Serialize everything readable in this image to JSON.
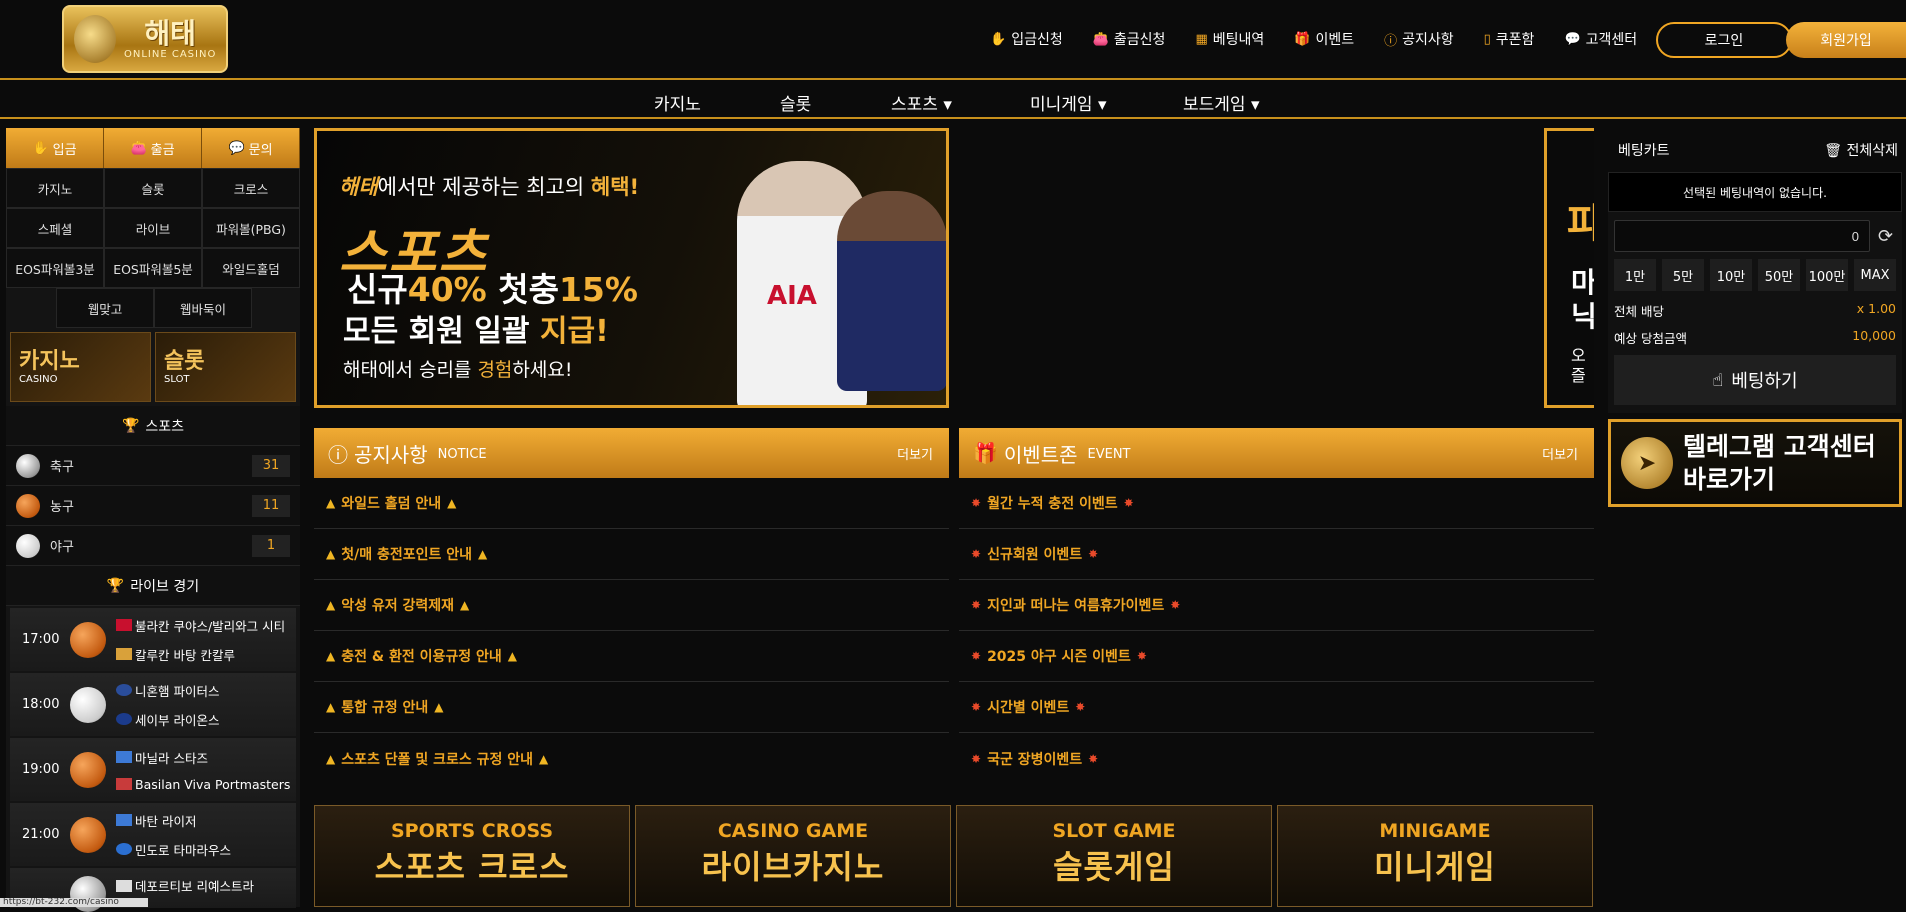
{
  "header": {
    "logo_text": "해태",
    "logo_sub": "ONLINE CASINO",
    "nav": [
      {
        "icon": "deposit-icon",
        "label": "입금신청"
      },
      {
        "icon": "withdraw-icon",
        "label": "출금신청"
      },
      {
        "icon": "history-icon",
        "label": "베팅내역"
      },
      {
        "icon": "gift-icon",
        "label": "이벤트"
      },
      {
        "icon": "notice-icon",
        "label": "공지사항"
      },
      {
        "icon": "coupon-icon",
        "label": "쿠폰함"
      },
      {
        "icon": "support-icon",
        "label": "고객센터"
      }
    ],
    "login": "로그인",
    "join": "회원가입"
  },
  "main_nav": [
    "카지노",
    "슬롯",
    "스포츠 ▾",
    "미니게임 ▾",
    "보드게임 ▾"
  ],
  "left": {
    "quick": [
      "입금",
      "출금",
      "문의"
    ],
    "games": [
      "카지노",
      "슬롯",
      "크로스",
      "스페셜",
      "라이브",
      "파워볼(PBG)",
      "EOS파워볼3분",
      "EOS파워볼5분",
      "와일드홀덤"
    ],
    "games2": [
      "웹맞고",
      "웹바둑이"
    ],
    "promo": [
      {
        "title": "카지노",
        "sub": "CASINO"
      },
      {
        "title": "슬롯",
        "sub": "SLOT"
      }
    ],
    "sports_title": "스포츠",
    "sports": [
      {
        "name": "축구",
        "count": "31"
      },
      {
        "name": "농구",
        "count": "11"
      },
      {
        "name": "야구",
        "count": "1"
      }
    ],
    "live_title": "라이브 경기",
    "live": [
      {
        "time": "17:00",
        "home": "불라칸 쿠야스/발리와그 시티",
        "away": "칼루칸 바탕 칸칼루"
      },
      {
        "time": "18:00",
        "home": "니혼햄 파이터스",
        "away": "세이부 라이온스"
      },
      {
        "time": "19:00",
        "home": "마닐라 스타즈",
        "away": "Basilan Viva Portmasters"
      },
      {
        "time": "21:00",
        "home": "바탄 라이저",
        "away": "민도로 타마라우스"
      },
      {
        "time": "",
        "home": "데포르티보 리예스트라",
        "away": ""
      }
    ],
    "status_url": "https://bt-232.com/casino"
  },
  "banner": {
    "line1_brand": "해태",
    "line1_rest": "에서만 제공하는 최고의 ",
    "line1_accent": "혜택!",
    "line2": "스포츠",
    "line3_a": "신규",
    "line3_b": "40%",
    "line3_c": " 첫충",
    "line3_d": "15%",
    "line4_a": "모든 회원 일괄 ",
    "line4_b": "지급!",
    "line5_a": "해태에서 승리를 ",
    "line5_b": "경험",
    "line5_c": "하세요!",
    "jersey": "AIA"
  },
  "banner2": {
    "a": "파",
    "b": "마\n닉",
    "c": "오\n즐"
  },
  "notice": {
    "title": "공지사항",
    "sub": "NOTICE",
    "more": "더보기",
    "items": [
      "와일드 홀덤 안내",
      "첫/매 충전포인트 안내",
      "악성 유저 강력제재",
      "충전 & 환전 이용규정 안내",
      "통합 규정 안내",
      "스포츠 단폴 및 크로스 규정 안내"
    ]
  },
  "event": {
    "title": "이벤트존",
    "sub": "EVENT",
    "more": "더보기",
    "items": [
      "월간 누적 충전 이벤트",
      "신규회원 이벤트",
      "지인과 떠나는 여름휴가이벤트",
      "2025 야구 시즌 이벤트",
      "시간별 이벤트",
      "국군 장병이벤트"
    ]
  },
  "games": [
    {
      "en": "SPORTS CROSS",
      "kr": "스포츠 크로스"
    },
    {
      "en": "CASINO GAME",
      "kr": "라이브카지노"
    },
    {
      "en": "SLOT GAME",
      "kr": "슬롯게임"
    },
    {
      "en": "MINIGAME",
      "kr": "미니게임"
    }
  ],
  "cart": {
    "title": "베팅카트",
    "clear": "전체삭제",
    "empty": "선택된 베팅내역이 없습니다.",
    "amount": "0",
    "chips": [
      "1만",
      "5만",
      "10만",
      "50만",
      "100만",
      "MAX"
    ],
    "total_odds_label": "전체 배당",
    "total_odds": "x 1.00",
    "expected_label": "예상 당첨금액",
    "expected": "10,000",
    "bet": "베팅하기"
  },
  "telegram": {
    "line1": "텔레그램 고객센터",
    "line2": "바로가기"
  },
  "colors": {
    "accent": "#f0a623",
    "bg": "#0b0b0b"
  }
}
